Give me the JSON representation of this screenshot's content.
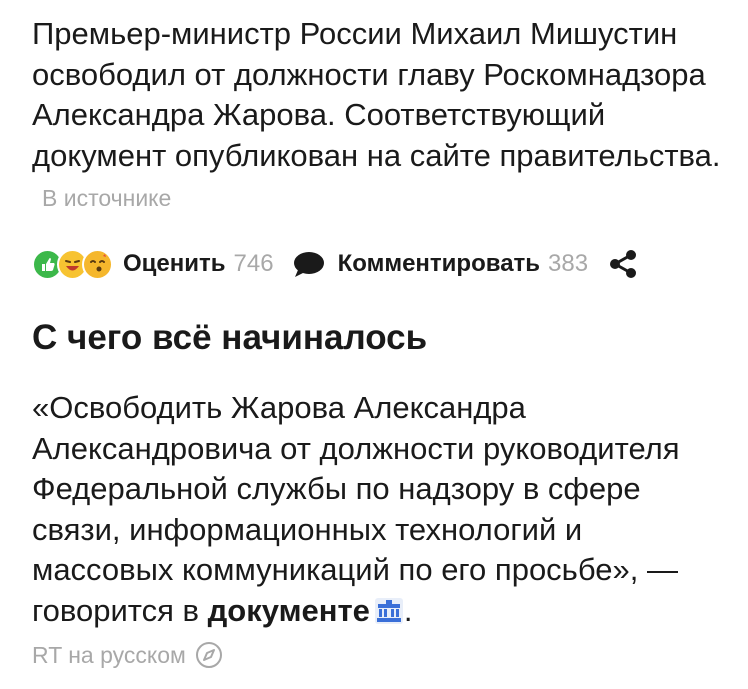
{
  "article": {
    "lead_text": "Премьер-министр России Михаил Мишустин освободил от должности главу Роскомнадзора Александра Жарова. Соответствующий документ опубликован на сайте правительства.",
    "source_link": "В источнике"
  },
  "actions": {
    "reactions_icons": [
      "like-icon",
      "laughing-face-icon",
      "kissing-face-icon"
    ],
    "rate_label": "Оценить",
    "rate_count": "746",
    "comment_label": "Комментировать",
    "comment_count": "383",
    "share_icon": "share-icon"
  },
  "section": {
    "heading": "С чего всё начиналось",
    "quote_text": "«Освободить Жарова Александра Александровича от должности руководителя Федеральной службы по надзору в сфере связи, информационных технологий и массовых коммуникаций по его просьбе», — говорится в ",
    "doc_link": "документе",
    "after_link": ".",
    "source": "RT на русском"
  },
  "colors": {
    "text": "#1a1a1a",
    "muted": "#a8a8a8",
    "like": "#3cb84a",
    "emoji_yellow": "#f7c331",
    "doc_icon_blue": "#3a6fd8"
  }
}
